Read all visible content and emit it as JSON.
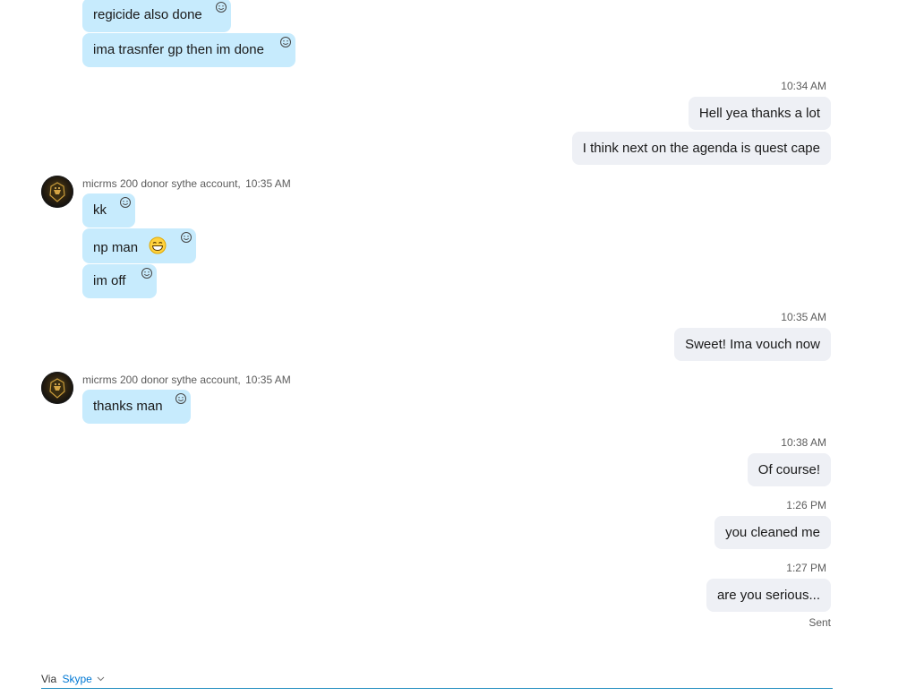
{
  "colors": {
    "incoming_bubble": "#c7ebfd",
    "outgoing_bubble": "#eef0f5",
    "accent": "#0078d4"
  },
  "icons": {
    "reaction": "smiley-outline-icon",
    "grin_emoji": "grinning-emoji-icon",
    "avatar": "dark-helmet-avatar-icon",
    "chevron": "chevron-down-icon"
  },
  "messages": {
    "m1": "regicide also done",
    "m2": "ima trasnfer gp then im done",
    "t1": "10:34 AM",
    "m3": "Hell yea thanks a lot",
    "m4": "I think next on the agenda is quest cape",
    "s1_name": "micrms 200 donor sythe account,",
    "s1_time": "10:35 AM",
    "m5": "kk",
    "m6": "np man",
    "m7": "im off",
    "t2": "10:35 AM",
    "m8": "Sweet! Ima vouch now",
    "s2_name": "micrms 200 donor sythe account,",
    "s2_time": "10:35 AM",
    "m9": "thanks man",
    "t3": "10:38 AM",
    "m10": "Of course!",
    "t4": "1:26 PM",
    "m11": "you cleaned me",
    "t5": "1:27 PM",
    "m12": "are you serious...",
    "status": "Sent"
  },
  "footer": {
    "via": "Via",
    "service": "Skype"
  }
}
